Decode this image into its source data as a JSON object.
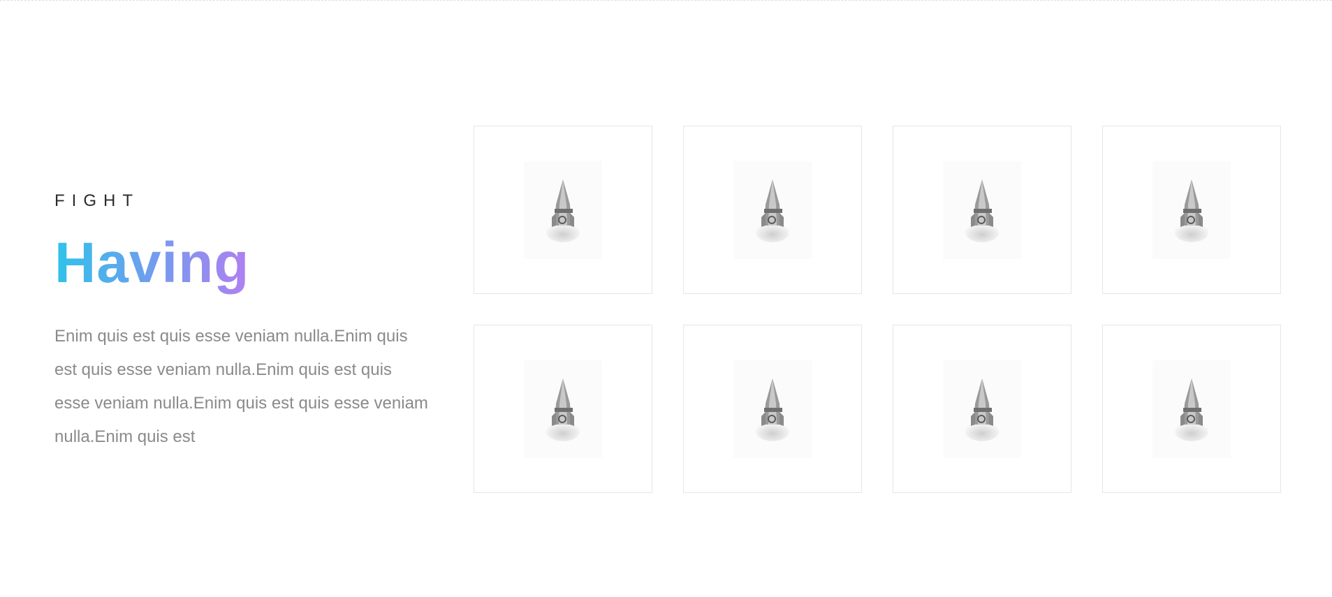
{
  "section": {
    "eyebrow": "FIGHT",
    "headline": "Having",
    "description": "Enim quis est quis esse veniam nulla.Enim quis est quis esse veniam nulla.Enim quis est quis esse veniam nulla.Enim quis est quis esse veniam nulla.Enim quis est"
  },
  "gallery": {
    "items": [
      {
        "icon": "rocket-icon"
      },
      {
        "icon": "rocket-icon"
      },
      {
        "icon": "rocket-icon"
      },
      {
        "icon": "rocket-icon"
      },
      {
        "icon": "rocket-icon"
      },
      {
        "icon": "rocket-icon"
      },
      {
        "icon": "rocket-icon"
      },
      {
        "icon": "rocket-icon"
      }
    ]
  },
  "colors": {
    "gradient_start": "#2fc3ea",
    "gradient_mid": "#6aa0ee",
    "gradient_end": "#b17ff0",
    "text_muted": "#8a8a8a",
    "tile_border": "#e6e6e6"
  }
}
